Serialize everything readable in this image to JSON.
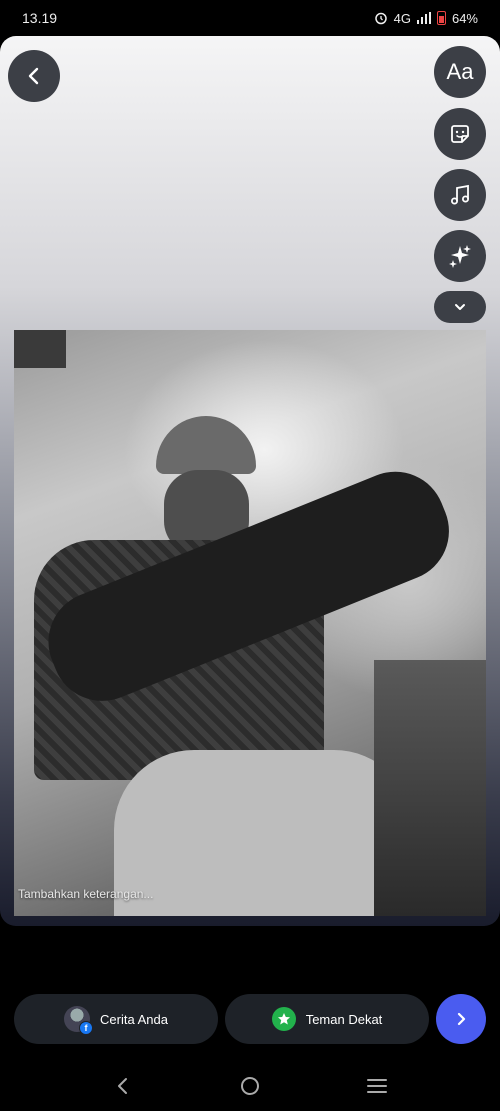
{
  "status_bar": {
    "time": "13.19",
    "network": "4G",
    "battery": "64%",
    "icons": [
      "alarm-icon",
      "signal-icon",
      "battery-icon"
    ]
  },
  "editor": {
    "toolbar": {
      "back": {
        "icon": "chevron-left-icon"
      },
      "text": {
        "label": "Aa"
      },
      "sticker": {
        "icon": "sticker-icon"
      },
      "music": {
        "icon": "music-note-icon"
      },
      "effects": {
        "icon": "sparkles-icon"
      },
      "more": {
        "icon": "chevron-down-icon"
      }
    },
    "photo": {
      "description_icon": "photo"
    },
    "caption_placeholder": "Tambahkan keterangan..."
  },
  "share_bar": {
    "your_story": {
      "label": "Cerita Anda",
      "icon": "avatar-facebook-icon"
    },
    "close_friends": {
      "label": "Teman Dekat",
      "icon": "green-star-icon",
      "color": "#22b24c"
    },
    "send": {
      "icon": "chevron-right-icon",
      "color": "#4a5cf0"
    }
  },
  "nav_bar": {
    "back": {
      "icon": "nav-back-icon"
    },
    "home": {
      "icon": "nav-home-icon"
    },
    "recents": {
      "icon": "nav-recents-icon"
    }
  }
}
